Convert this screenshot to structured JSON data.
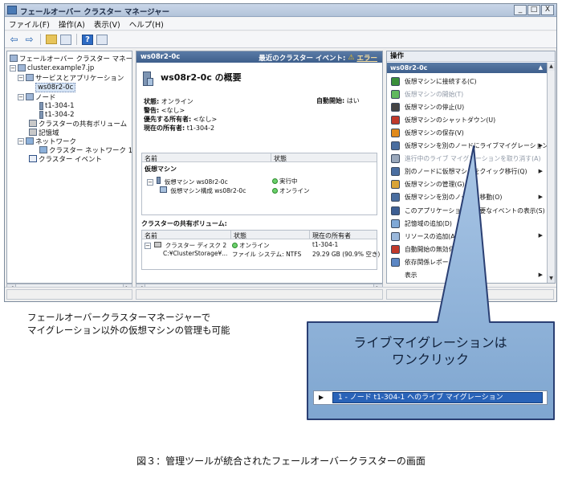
{
  "window": {
    "title": "フェールオーバー クラスター マネージャー",
    "controls": [
      "_",
      "□",
      "X"
    ]
  },
  "menubar": [
    "ファイル(F)",
    "操作(A)",
    "表示(V)",
    "ヘルプ(H)"
  ],
  "tree": {
    "root": "フェールオーバー クラスター マネージャー",
    "cluster": "cluster.example7.jp",
    "services": "サービスとアプリケーション",
    "selected_vm": "ws08r2-0c",
    "nodes": "ノード",
    "node1": "t1-304-1",
    "node2": "t1-304-2",
    "shared_volumes": "クラスターの共有ボリューム",
    "storage": "記憶域",
    "network": "ネットワーク",
    "network1": "クラスター ネットワーク 1",
    "events": "クラスター イベント"
  },
  "center": {
    "header_left": "ws08r2-0c",
    "header_right_label": "最近のクラスター イベント:",
    "header_right_link": "エラー",
    "overview_title": "ws08r2-0c の概要",
    "status_label": "状態:",
    "status_value": "オンライン",
    "warning_label": "警告:",
    "warning_value": "<なし>",
    "preferred_owner_label": "優先する所有者:",
    "preferred_owner_value": "<なし>",
    "current_owner_label": "現在の所有者:",
    "current_owner_value": "t1-304-2",
    "auto_start_label": "自動開始:",
    "auto_start_value": "はい",
    "vm_grid": {
      "columns": [
        "名前",
        "状態"
      ],
      "group": "仮想マシン",
      "rows": [
        {
          "name": "仮想マシン ws08r2-0c",
          "status": "実行中"
        },
        {
          "name": "仮想マシン構成 ws08r2-0c",
          "status": "オンライン"
        }
      ]
    },
    "csv_title": "クラスターの共有ボリューム:",
    "csv_grid": {
      "columns": [
        "名前",
        "状態",
        "現在の所有者"
      ],
      "row_name": "クラスター ディスク 2",
      "row_status": "オンライン",
      "row_owner": "t1-304-1",
      "row_path": "C:¥ClusterStorage¥...",
      "row_fs": "ファイル システム: NTFS",
      "row_free": "29.29 GB (90.9% 空き)"
    }
  },
  "actions": {
    "header": "操作",
    "sub_header": "ws08r2-0c",
    "items": [
      {
        "label": "仮想マシンに接続する(C)",
        "icon": "connect-icon",
        "color": "#3a8f3a",
        "dim": false,
        "submenu": false
      },
      {
        "label": "仮想マシンの開始(T)",
        "icon": "start-icon",
        "color": "#5fb95f",
        "dim": true,
        "submenu": false
      },
      {
        "label": "仮想マシンの停止(U)",
        "icon": "stop-icon",
        "color": "#444444",
        "dim": false,
        "submenu": false
      },
      {
        "label": "仮想マシンのシャットダウン(U)",
        "icon": "shutdown-icon",
        "color": "#c0392b",
        "dim": false,
        "submenu": false
      },
      {
        "label": "仮想マシンの保存(V)",
        "icon": "save-icon",
        "color": "#e08a1c",
        "dim": false,
        "submenu": false
      },
      {
        "label": "仮想マシンを別のノードにライブマイグレーション",
        "icon": "live-migrate-icon",
        "color": "#4a6ea0",
        "dim": false,
        "submenu": true
      },
      {
        "label": "進行中のライブ マイグレーションを取り消す(A)",
        "icon": "cancel-migrate-icon",
        "color": "#9aa8bb",
        "dim": true,
        "submenu": false
      },
      {
        "label": "別のノードに仮想マシンをクイック移行(Q)",
        "icon": "quick-migrate-icon",
        "color": "#4a6ea0",
        "dim": false,
        "submenu": true
      },
      {
        "label": "仮想マシンの管理(G)",
        "icon": "manage-vm-icon",
        "color": "#d9a437",
        "dim": false,
        "submenu": false
      },
      {
        "label": "仮想マシンを別のノードに移動(O)",
        "icon": "move-icon",
        "color": "#4a6ea0",
        "dim": false,
        "submenu": true
      },
      {
        "label": "このアプリケーションの重要なイベントの表示(S)",
        "icon": "events-icon",
        "color": "#3d5f93",
        "dim": false,
        "submenu": false
      },
      {
        "label": "記憶域の追加(D)",
        "icon": "add-storage-icon",
        "color": "#7fa8d6",
        "dim": false,
        "submenu": false
      },
      {
        "label": "リソースの追加(A)",
        "icon": "add-resource-icon",
        "color": "#9ab8dc",
        "dim": false,
        "submenu": true
      },
      {
        "label": "自動開始の無効化",
        "icon": "disable-autostart-icon",
        "color": "#c0392b",
        "dim": false,
        "submenu": false
      },
      {
        "label": "依存関係レポートの表示(Y)",
        "icon": "report-icon",
        "color": "#5b86c4",
        "dim": false,
        "submenu": false
      },
      {
        "label": "表示",
        "icon": "view-icon",
        "color": "#ffffff",
        "dim": false,
        "submenu": true
      }
    ]
  },
  "caption_lines": [
    "フェールオーバークラスターマネージャーで",
    "マイグレーション以外の仮想マシンの管理も可能"
  ],
  "callout": {
    "title_line1": "ライブマイグレーションは",
    "title_line2": "ワンクリック",
    "highlight": "1 - ノード t1-304-1 へのライブ マイグレーション"
  },
  "figure_caption": "図３：管理ツールが統合されたフェールオーバークラスターの画面",
  "colors": {
    "accent": "#3e5f8c",
    "callout_fill": "#8fb4d9",
    "callout_border": "#2a3f73",
    "highlight": "#2a63b8"
  }
}
